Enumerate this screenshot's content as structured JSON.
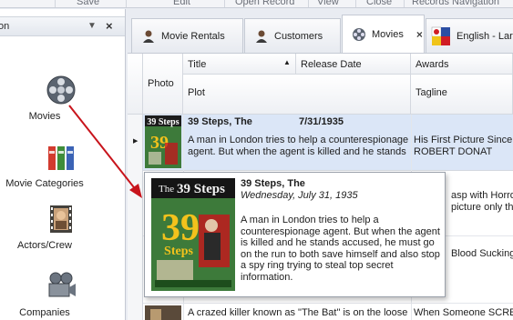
{
  "ribbon": {
    "groups": [
      "Save",
      "Edit",
      "Open Record",
      "View",
      "Close",
      "Records Navigation"
    ]
  },
  "nav": {
    "header_title": "on",
    "items": [
      {
        "label": "Movies",
        "icon": "film-reel-icon"
      },
      {
        "label": "Movie Categories",
        "icon": "bookshelf-icon"
      },
      {
        "label": "Actors/Crew",
        "icon": "actor-filmstrip-icon"
      },
      {
        "label": "Companies",
        "icon": "camera-icon"
      }
    ]
  },
  "tabs": [
    {
      "label": "Movie Rentals",
      "icon": "person-icon"
    },
    {
      "label": "Customers",
      "icon": "person-icon"
    },
    {
      "label": "Movies",
      "icon": "film-reel-icon",
      "active": true
    },
    {
      "label": "English - Lar",
      "icon": "flag-icon"
    }
  ],
  "grid": {
    "columns": {
      "photo": "Photo",
      "title": "Title",
      "release_date": "Release Date",
      "awards": "Awards",
      "plot": "Plot",
      "tagline": "Tagline"
    },
    "rows": [
      {
        "title": "39 Steps, The",
        "release_date": "7/31/1935",
        "plot_line1": "A man in London tries to help a counterespionage",
        "plot_line2": "agent. But when the agent is killed and he stands",
        "awards_line1": "His First Picture Since \"",
        "awards_line2": "ROBERT DONAT"
      }
    ],
    "partial_right": {
      "line1": "asp with Horror",
      "line2": "picture only the",
      "line3": "Blood Sucking"
    },
    "bottom_row": {
      "plot": "A crazed killer known as \"The Bat\" is on the loose",
      "tagline": "When Someone SCREA"
    }
  },
  "tooltip": {
    "title": "39 Steps, The",
    "date": "Wednesday, July 31, 1935",
    "plot": "A man in London tries to help a counterespionage agent. But when the agent is killed and he stands accused, he must go on the run to both save himself and also stop a spy ring trying to steal top secret information."
  },
  "poster": {
    "brand": "The",
    "title_num": "39",
    "title_word": "Steps"
  },
  "colors": {
    "selection": "#dbe6f7",
    "accent_red": "#c8141c",
    "poster_green": "#3d7a3a",
    "poster_yellow": "#f3c21c"
  }
}
